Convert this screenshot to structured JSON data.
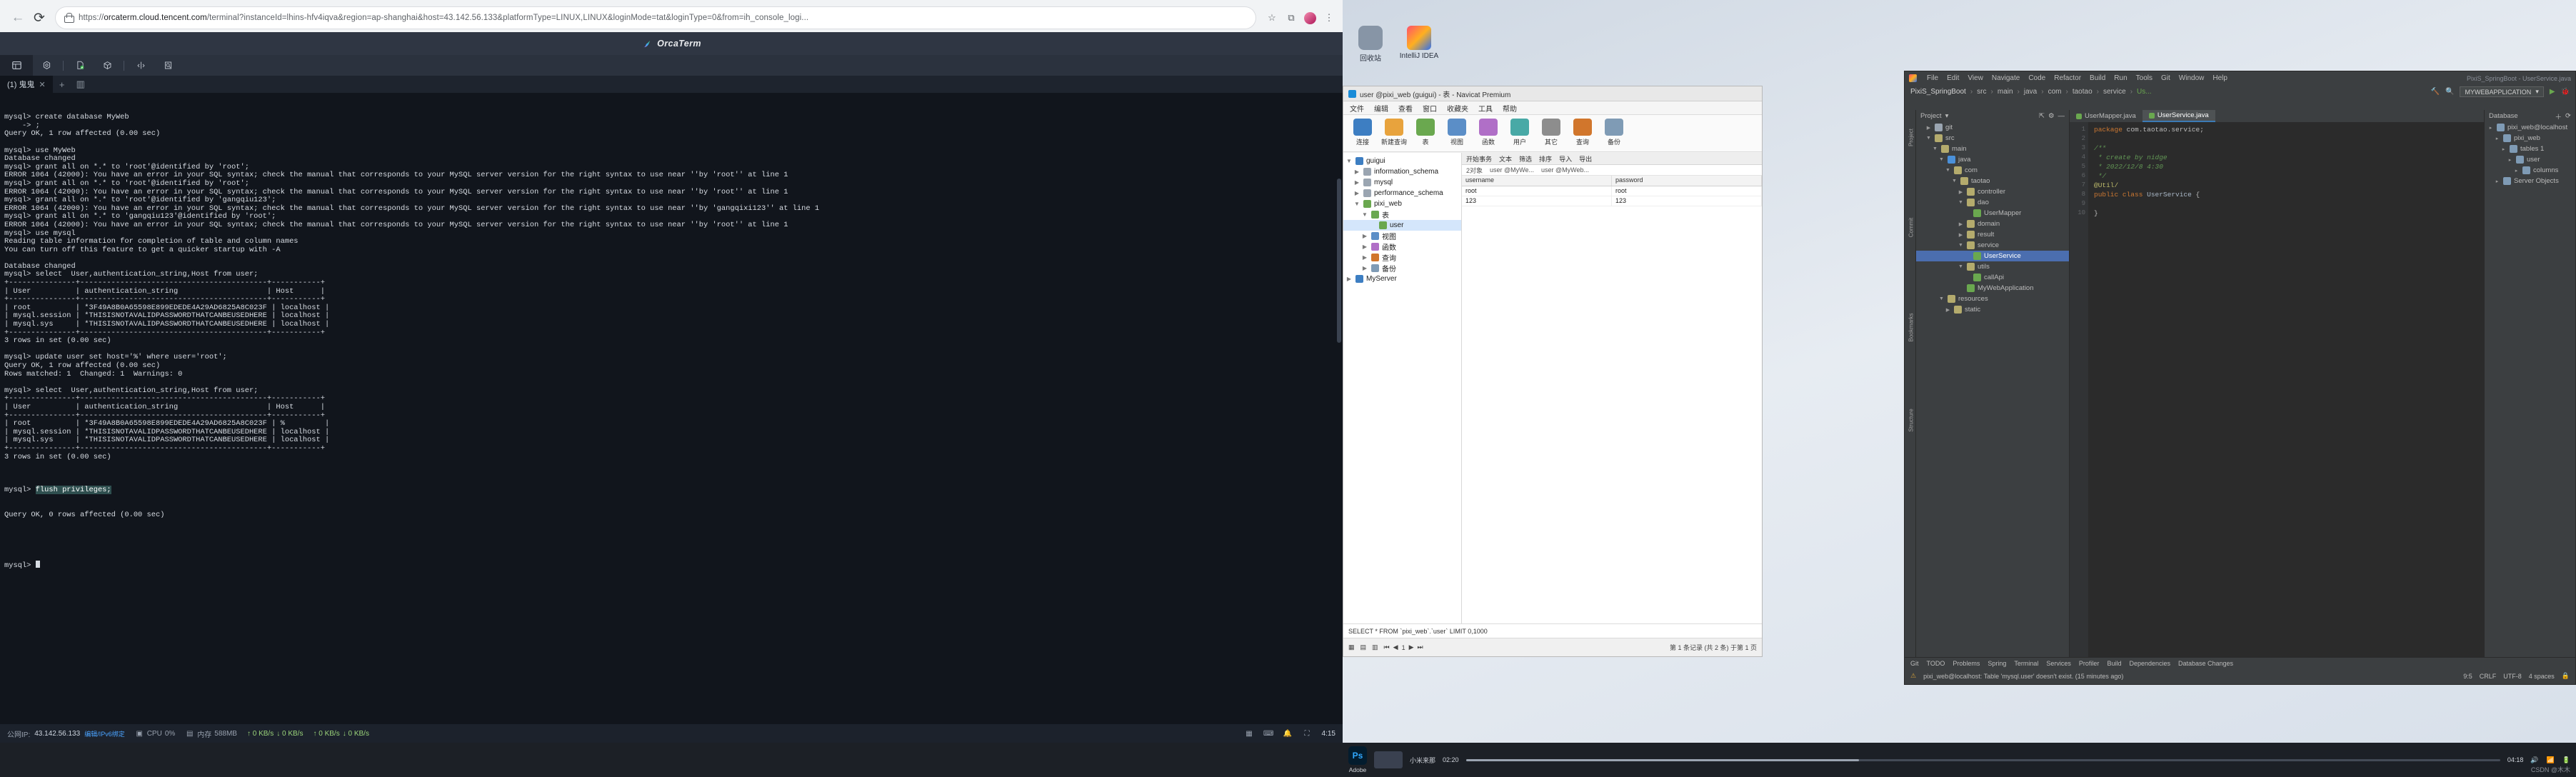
{
  "browser": {
    "url_prefix": "https://",
    "url_domain": "orcaterm.cloud.tencent.com",
    "url_path": "/terminal?instanceId=lhins-hfv4iqva&region=ap-shanghai&host=43.142.56.133&platformType=LINUX,LINUX&loginMode=tat&loginType=0&from=ih_console_logi...",
    "back_icon": "back-arrow-icon",
    "reload_icon": "reload-icon",
    "lock_icon": "lock-icon",
    "extensions_icon": "puzzle-icon",
    "bookmark_icon": "star-icon",
    "menu_icon": "more-vertical-icon"
  },
  "orcaterm": {
    "app_title": "OrcaTerm",
    "toolbar": [
      {
        "name": "layout-icon",
        "glyph": "▤"
      },
      {
        "name": "settings-gear-icon",
        "glyph": "⬡"
      },
      {
        "name": "file-transfer-icon",
        "glyph": "🗋"
      },
      {
        "name": "package-icon",
        "glyph": "📦"
      },
      {
        "name": "split-icon",
        "glyph": "⇅"
      },
      {
        "name": "search-file-icon",
        "glyph": "🔍"
      }
    ],
    "tab_label": "(1) 鬼鬼",
    "tab_close": "✕",
    "new_tab": "+",
    "split_view": "▥",
    "terminal_lines": [
      "mysql> create database MyWeb",
      "    -> ;",
      "Query OK, 1 row affected (0.00 sec)",
      "",
      "mysql> use MyWeb",
      "Database changed",
      "mysql> grant all on *.* to 'root'@identified by 'root';",
      "ERROR 1064 (42000): You have an error in your SQL syntax; check the manual that corresponds to your MySQL server version for the right syntax to use near ''by 'root'' at line 1",
      "mysql> grant all on *.* to 'root'@identified by 'root';",
      "ERROR 1064 (42000): You have an error in your SQL syntax; check the manual that corresponds to your MySQL server version for the right syntax to use near ''by 'root'' at line 1",
      "mysql> grant all on *.* to 'root'@identified by 'gangqiu123';",
      "ERROR 1064 (42000): You have an error in your SQL syntax; check the manual that corresponds to your MySQL server version for the right syntax to use near ''by 'gangqixi123'' at line 1",
      "mysql> grant all on *.* to 'gangqiu123'@identified by 'root';",
      "ERROR 1064 (42000): You have an error in your SQL syntax; check the manual that corresponds to your MySQL server version for the right syntax to use near ''by 'root'' at line 1",
      "mysql> use mysql",
      "Reading table information for completion of table and column names",
      "You can turn off this feature to get a quicker startup with -A",
      "",
      "Database changed",
      "mysql> select  User,authentication_string,Host from user;",
      "+---------------+------------------------------------------+-----------+",
      "| User          | authentication_string                    | Host      |",
      "+---------------+------------------------------------------+-----------+",
      "| root          | *3F49A8B0A65598E899EDEDE4A29AD6825A8C023F | localhost |",
      "| mysql.session | *THISISNOTAVALIDPASSWORDTHATCANBEUSEDHERE | localhost |",
      "| mysql.sys     | *THISISNOTAVALIDPASSWORDTHATCANBEUSEDHERE | localhost |",
      "+---------------+------------------------------------------+-----------+",
      "3 rows in set (0.00 sec)",
      "",
      "mysql> update user set host='%' where user='root';",
      "Query OK, 1 row affected (0.00 sec)",
      "Rows matched: 1  Changed: 1  Warnings: 0",
      "",
      "mysql> select  User,authentication_string,Host from user;",
      "+---------------+------------------------------------------+-----------+",
      "| User          | authentication_string                    | Host      |",
      "+---------------+------------------------------------------+-----------+",
      "| root          | *3F49A8B0A65598E899EDEDE4A29AD6825A8C023F | %         |",
      "| mysql.session | *THISISNOTAVALIDPASSWORDTHATCANBEUSEDHERE | localhost |",
      "| mysql.sys     | *THISISNOTAVALIDPASSWORDTHATCANBEUSEDHERE | localhost |",
      "+---------------+------------------------------------------+-----------+",
      "3 rows in set (0.00 sec)",
      ""
    ],
    "highlight_command": "flush privileges;",
    "highlight_prompt": "mysql> ",
    "after_highlight": "Query OK, 0 rows affected (0.00 sec)",
    "final_prompt": "mysql> ",
    "status": {
      "label": "公网IP:",
      "ip": "43.142.56.133",
      "link": "编辑/IPv6绑定",
      "cpu_label": "CPU",
      "cpu_value": "0%",
      "mem_label": "内存",
      "mem_value": "588MB",
      "net_up": "↑ 0 KB/s",
      "net_down": "↓ 0 KB/s",
      "net_up2": "↑ 0 KB/s",
      "net_down2": "↓ 0 KB/s",
      "time": "4:15"
    }
  },
  "desktop": {
    "icons": [
      {
        "label": "回收站",
        "name": "recycle-bin-icon",
        "color": "#6d7f92"
      },
      {
        "label": "IntelliJ IDEA",
        "name": "intellij-idea-icon",
        "color": "#e8402a"
      }
    ]
  },
  "navicat": {
    "window_title": "user @pixi_web (guigui) - 表 - Navicat Premium",
    "menubar": [
      "文件",
      "编辑",
      "查看",
      "窗口",
      "收藏夹",
      "工具",
      "帮助"
    ],
    "toolbar": [
      {
        "label": "连接",
        "name": "connection-button",
        "color": "#3d7ec2"
      },
      {
        "label": "新建查询",
        "name": "new-query-button",
        "color": "#e8a33d"
      },
      {
        "label": "表",
        "name": "table-button",
        "color": "#6aa84f"
      },
      {
        "label": "视图",
        "name": "view-button",
        "color": "#5b8ec7"
      },
      {
        "label": "函数",
        "name": "function-button",
        "color": "#b06fc7"
      },
      {
        "label": "用户",
        "name": "user-button",
        "color": "#48a9a6"
      },
      {
        "label": "其它",
        "name": "other-button",
        "color": "#8d8d8d"
      },
      {
        "label": "查询",
        "name": "query-button",
        "color": "#d1762c"
      },
      {
        "label": "备份",
        "name": "backup-button",
        "color": "#7f9bb5"
      }
    ],
    "tree": [
      {
        "label": "guigui",
        "depth": 0,
        "arrow": "▼",
        "color": "#3d7ec2",
        "name": "tree-connection-guigui"
      },
      {
        "label": "information_schema",
        "depth": 1,
        "arrow": "▶",
        "color": "#9aa5b1",
        "name": "tree-db-information-schema"
      },
      {
        "label": "mysql",
        "depth": 1,
        "arrow": "▶",
        "color": "#9aa5b1",
        "name": "tree-db-mysql"
      },
      {
        "label": "performance_schema",
        "depth": 1,
        "arrow": "▶",
        "color": "#9aa5b1",
        "name": "tree-db-performance-schema"
      },
      {
        "label": "pixi_web",
        "depth": 1,
        "arrow": "▼",
        "color": "#6aa84f",
        "name": "tree-db-pixi-web"
      },
      {
        "label": "表",
        "depth": 2,
        "arrow": "▼",
        "color": "#6aa84f",
        "name": "tree-folder-tables"
      },
      {
        "label": "user",
        "depth": 3,
        "arrow": "",
        "color": "#6aa84f",
        "name": "tree-table-user",
        "selected": true
      },
      {
        "label": "视图",
        "depth": 2,
        "arrow": "▶",
        "color": "#5b8ec7",
        "name": "tree-folder-views"
      },
      {
        "label": "函数",
        "depth": 2,
        "arrow": "▶",
        "color": "#b06fc7",
        "name": "tree-folder-functions"
      },
      {
        "label": "查询",
        "depth": 2,
        "arrow": "▶",
        "color": "#d1762c",
        "name": "tree-folder-queries"
      },
      {
        "label": "备份",
        "depth": 2,
        "arrow": "▶",
        "color": "#7f9bb5",
        "name": "tree-folder-backups"
      },
      {
        "label": "MyServer",
        "depth": 0,
        "arrow": "▶",
        "color": "#3d7ec2",
        "name": "tree-connection-myserver"
      }
    ],
    "result_tabs": [
      "开始事务",
      "文本",
      "筛选",
      "排序",
      "导入",
      "导出"
    ],
    "object_count": "2对象",
    "content_tabs": [
      "user @MyWe...",
      "user @MyWeb..."
    ],
    "grid": {
      "columns": [
        "username",
        "password"
      ],
      "rows": [
        [
          "root",
          "root"
        ],
        [
          "123",
          "123"
        ]
      ]
    },
    "sql_preview": "SELECT * FROM `pixi_web`.`user` LIMIT 0,1000",
    "footer": {
      "page_current": "1",
      "record_info": "第 1 条记录 (共 2 条) 于第 1 页",
      "grid_icons": [
        "grid-view-icon",
        "form-view-icon",
        "chart-view-icon"
      ]
    }
  },
  "intellij": {
    "title": "PixiS_SpringBoot",
    "menubar": [
      "File",
      "Edit",
      "View",
      "Navigate",
      "Code",
      "Refactor",
      "Build",
      "Run",
      "Tools",
      "Git",
      "Window",
      "Help"
    ],
    "title_right": "PixiS_SpringBoot - UserService.java",
    "breadcrumb": [
      "PixiS_SpringBoot",
      "src",
      "main",
      "java",
      "com",
      "taotao",
      "service",
      "Us...",
      "UserService.java"
    ],
    "run_config": "MYWEBAPPLICATION",
    "project_label": "Project",
    "tree": [
      {
        "label": "git",
        "depth": 1,
        "arrow": "▶",
        "color": "#9aa5b1",
        "name": "tree-folder-git"
      },
      {
        "label": "src",
        "depth": 1,
        "arrow": "▼",
        "color": "#b4ab6d",
        "name": "tree-folder-src"
      },
      {
        "label": "main",
        "depth": 2,
        "arrow": "▼",
        "color": "#b4ab6d",
        "name": "tree-folder-main"
      },
      {
        "label": "java",
        "depth": 3,
        "arrow": "▼",
        "color": "#4a90d9",
        "name": "tree-folder-java"
      },
      {
        "label": "com",
        "depth": 4,
        "arrow": "▼",
        "color": "#b4ab6d",
        "name": "tree-folder-com"
      },
      {
        "label": "taotao",
        "depth": 5,
        "arrow": "▼",
        "color": "#b4ab6d",
        "name": "tree-folder-taotao"
      },
      {
        "label": "controller",
        "depth": 6,
        "arrow": "▶",
        "color": "#b4ab6d",
        "name": "tree-folder-controller"
      },
      {
        "label": "dao",
        "depth": 6,
        "arrow": "▼",
        "color": "#b4ab6d",
        "name": "tree-folder-dao"
      },
      {
        "label": "UserMapper",
        "depth": 7,
        "arrow": "",
        "color": "#6aa84f",
        "name": "tree-file-usermapper"
      },
      {
        "label": "domain",
        "depth": 6,
        "arrow": "▶",
        "color": "#b4ab6d",
        "name": "tree-folder-domain"
      },
      {
        "label": "result",
        "depth": 6,
        "arrow": "▶",
        "color": "#b4ab6d",
        "name": "tree-folder-result"
      },
      {
        "label": "service",
        "depth": 6,
        "arrow": "▼",
        "color": "#b4ab6d",
        "name": "tree-folder-service"
      },
      {
        "label": "UserService",
        "depth": 7,
        "arrow": "",
        "color": "#6aa84f",
        "name": "tree-file-userservice",
        "selected": true
      },
      {
        "label": "utils",
        "depth": 6,
        "arrow": "▼",
        "color": "#b4ab6d",
        "name": "tree-folder-utils"
      },
      {
        "label": "callApi",
        "depth": 7,
        "arrow": "",
        "color": "#6aa84f",
        "name": "tree-file-callapi"
      },
      {
        "label": "MyWebApplication",
        "depth": 6,
        "arrow": "",
        "color": "#6aa84f",
        "name": "tree-file-mywebapplication"
      },
      {
        "label": "resources",
        "depth": 3,
        "arrow": "▼",
        "color": "#b4ab6d",
        "name": "tree-folder-resources"
      },
      {
        "label": "static",
        "depth": 4,
        "arrow": "▶",
        "color": "#b4ab6d",
        "name": "tree-folder-static"
      }
    ],
    "editor_tabs": [
      {
        "label": "UserMapper.java",
        "active": false,
        "name": "tab-usermapper"
      },
      {
        "label": "UserService.java",
        "active": true,
        "name": "tab-userservice"
      }
    ],
    "code": [
      {
        "n": "1",
        "html": "<span class=\"kw\">package</span> com.taotao.service;"
      },
      {
        "n": "2",
        "html": ""
      },
      {
        "n": "3",
        "html": "<span class=\"cm\">/**</span>"
      },
      {
        "n": "4",
        "html": "<span class=\"cm\"> * create by nidge</span>"
      },
      {
        "n": "5",
        "html": "<span class=\"cm\"> * 2022/12/8 4:30</span>"
      },
      {
        "n": "6",
        "html": "<span class=\"cm\"> */</span>"
      },
      {
        "n": "7",
        "html": "<span class=\"ann\">@Util/</span>"
      },
      {
        "n": "8",
        "html": "<span class=\"kw\">public class</span> <span class=\"cls\">UserService</span> {"
      },
      {
        "n": "9",
        "html": ""
      },
      {
        "n": "10",
        "html": "}"
      }
    ],
    "database_panel": {
      "title": "Database",
      "items": [
        {
          "label": "pixi_web@localhost",
          "depth": 0,
          "name": "db-connection"
        },
        {
          "label": "pixi_web",
          "depth": 1,
          "name": "db-schema-pixi-web"
        },
        {
          "label": "tables 1",
          "depth": 2,
          "name": "db-folder-tables"
        },
        {
          "label": "user",
          "depth": 3,
          "name": "db-table-user"
        },
        {
          "label": "columns",
          "depth": 4,
          "name": "db-folder-columns"
        },
        {
          "label": "Server Objects",
          "depth": 1,
          "name": "db-server-objects"
        }
      ]
    },
    "toolwindows": [
      "Git",
      "TODO",
      "Problems",
      "Spring",
      "Terminal",
      "Services",
      "Profiler",
      "Build",
      "Dependencies",
      "Database Changes"
    ],
    "status_message": "pixi_web@localhost: Table 'mysql.user' doesn't exist. (15 minutes ago)",
    "status_right": [
      "9:5",
      "CRLF",
      "UTF-8",
      "4 spaces"
    ]
  },
  "taskbar": {
    "app_label": "Adobe",
    "app_name": "Ps",
    "media_title": "小米来那",
    "time_left": "02:20",
    "time_right": "04:18",
    "right_items": [
      "volume-icon",
      "network-icon",
      "battery-icon"
    ]
  },
  "watermark": "CSDN @木木"
}
